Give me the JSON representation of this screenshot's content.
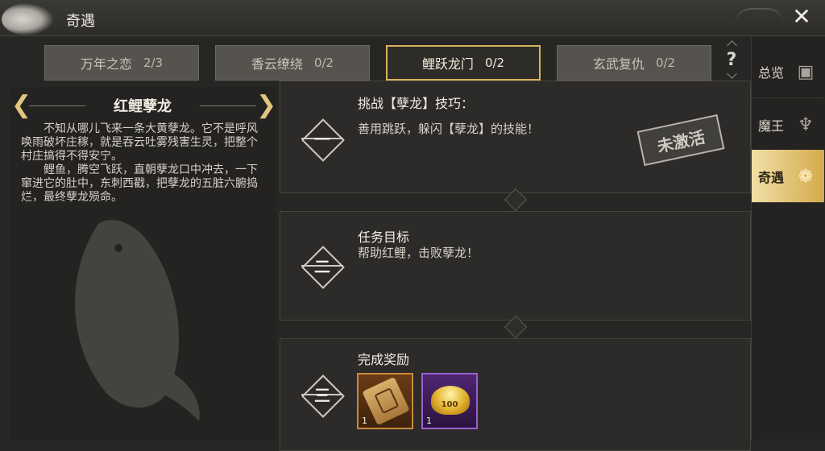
{
  "window": {
    "title": "奇遇",
    "close": "✕"
  },
  "tabs": [
    {
      "label": "万年之恋",
      "count": "2/3"
    },
    {
      "label": "香云缭绕",
      "count": "0/2"
    },
    {
      "label": "鲤跃龙门",
      "count": "0/2"
    },
    {
      "label": "玄武复仇",
      "count": "0/2"
    }
  ],
  "help": "?",
  "sidenav": [
    {
      "label": "总览",
      "icon": "overview-icon",
      "glyph": "▣"
    },
    {
      "label": "魔王",
      "icon": "demon-king-icon",
      "glyph": "♆"
    },
    {
      "label": "奇遇",
      "icon": "adventure-icon",
      "glyph": "❁"
    }
  ],
  "story": {
    "title": "红鲤孽龙",
    "prev": "❮",
    "next": "❯",
    "paragraphs": [
      "不知从哪儿飞来一条大黄孽龙。它不是呼风唤雨破坏庄稼，就是吞云吐雾残害生灵，把整个村庄搞得不得安宁。",
      "鲤鱼，腾空飞跃，直朝孽龙口中冲去，一下窜进它的肚中，东刺西戳，把孽龙的五脏六腑捣烂，最终孽龙殒命。"
    ]
  },
  "steps": [
    {
      "num": "一",
      "title": "挑战【孽龙】技巧：",
      "desc": "善用跳跃，躲闪【孽龙】的技能！"
    },
    {
      "num": "二",
      "title": "任务目标",
      "desc": "帮助红鲤，击败孽龙！"
    },
    {
      "num": "三",
      "title": "完成奖励",
      "desc": ""
    }
  ],
  "stamp": "未激活",
  "rewards": [
    {
      "icon": "scroll-icon",
      "qty": "1",
      "rarity": "orange"
    },
    {
      "icon": "gold-ingot-icon",
      "qty": "1",
      "label": "100",
      "rarity": "purple"
    }
  ]
}
